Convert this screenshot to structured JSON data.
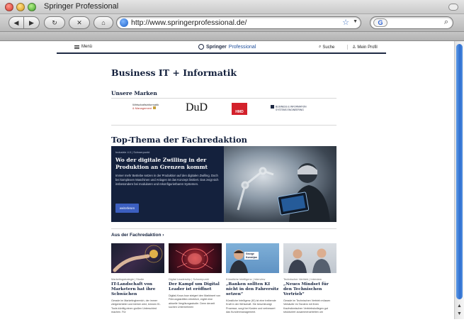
{
  "window": {
    "title": "Springer Professional"
  },
  "toolbar": {
    "url": "http://www.springerprofessional.de/",
    "search_badge": "G"
  },
  "header": {
    "menu_label": "Menü",
    "logo_springer": "Springer",
    "logo_professional": "Professional",
    "search_label": "Suche",
    "profile_label": "Mein Profil"
  },
  "page": {
    "title": "Business IT + Informatik",
    "brands_heading": "Unsere Marken",
    "brands": {
      "wi_line1": "Wirtschaftsinformatik",
      "wi_line2": "& Management",
      "dud": "DuD",
      "hmd": "HMD",
      "bi_line1": "BUSINESS & INFORMATION",
      "bi_line2": "SYSTEMS ENGINEERING"
    },
    "topic_heading": "Top-Thema der Fachredaktion",
    "hero": {
      "kicker": "Industrie 4.0 | Schwerpunkt",
      "headline": "Wo der digitale Zwilling in der Produktion an Grenzen kommt",
      "body": "Immer mehr Betriebe setzen in der Produktion auf den digitalen Zwilling. Doch bei komplexen Maschinen und Anlagen ist das Konzept limitiert. Das zeigt sich insbesondere bei modularen und rekonfigurierbaren Systemen.",
      "button": "weiterlesen"
    },
    "fach_heading": "Aus der Fachredaktion ›",
    "cards": [
      {
        "meta": "Marketingstrategie | Studie",
        "title": "IT-Landschaft von Marketern hat ihre Schwächen",
        "text": "Gerade im Marketingbereich, der immer zielgerichteter und kleiner wird, können KI-Tools künftig einen großen Unterschied machen. Für"
      },
      {
        "meta": "Digital Leadership | Schwerpunkt",
        "title": "Der Kampf um Digital Leader ist eröffnet",
        "text": "Digital-Know-how steigert den Marktwert von Führungskräften erheblich, ergibt eine aktuelle Vergütungsstudie. Denn derzeit suchen Unternehmen"
      },
      {
        "meta": "Künstliche Intelligenz | Interview",
        "title": "„Banken sollten KI nicht in den Fahrersitz setzen“",
        "text": "Künstliche Intelligenz (KI) ist eine treibende Kraft in der Wirtschaft. Sie beschleunigt Prozesse, sorgt bei Kosten und verbessert das Kundenmanagement.",
        "badge_line1": "George",
        "badge_line2": "Konstrjan"
      },
      {
        "meta": "Technischer Vertrieb | Interview",
        "title": "„Neues Mindset für den Technischen Vertrieb“",
        "text": "Gerade im Technischen Vertrieb müssen Verkäufer im Tandem mit ihren Kaufmännischen Vertriebskollegen gut strukturiert zusammenarbeiten um"
      }
    ]
  }
}
